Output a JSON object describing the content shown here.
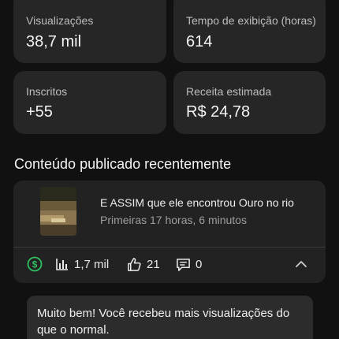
{
  "stats": [
    {
      "label": "Visualizações",
      "value": "38,7 mil"
    },
    {
      "label": "Tempo de exibição (horas)",
      "value": "614"
    },
    {
      "label": "Inscritos",
      "value": "+55"
    },
    {
      "label": "Receita estimada",
      "value": "R$ 24,78"
    }
  ],
  "recent": {
    "section_title": "Conteúdo publicado recentemente",
    "video": {
      "title": "E ASSIM que ele encontrou Ouro no rio",
      "subtitle": "Primeiras 17 horas, 6 minutos"
    },
    "metrics": {
      "monetization_icon": "dollar-circle-icon",
      "views": "1,7 mil",
      "likes": "21",
      "comments": "0"
    },
    "insight": "Muito bem! Você recebeu mais visualizações do que o normal."
  },
  "colors": {
    "background": "#111111",
    "card": "#262626",
    "monetization_green": "#2fbf5f"
  }
}
